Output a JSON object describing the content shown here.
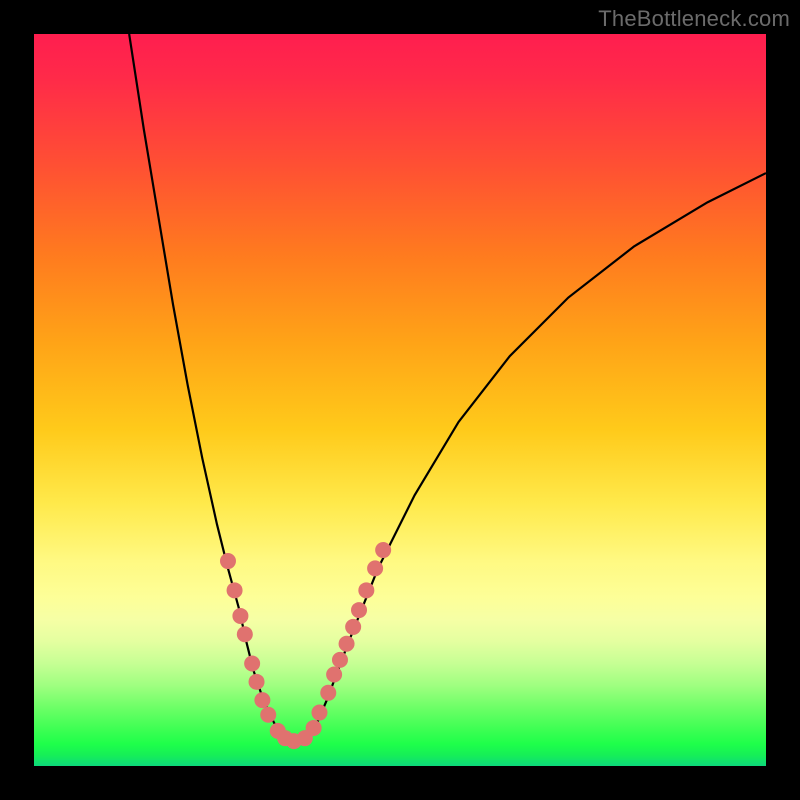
{
  "watermark": {
    "text": "TheBottleneck.com"
  },
  "colors": {
    "curve_stroke": "#000000",
    "marker_fill": "#e0726f",
    "marker_stroke": "#c85a58"
  },
  "chart_data": {
    "type": "line",
    "title": "",
    "xlabel": "",
    "ylabel": "",
    "xlim": [
      0,
      100
    ],
    "ylim": [
      0,
      100
    ],
    "grid": false,
    "legend": false,
    "series": [
      {
        "name": "bottleneck-curve",
        "x": [
          13,
          15,
          17,
          19,
          21,
          23,
          25,
          26.5,
          28,
          29,
          30,
          31,
          32,
          33,
          34,
          35,
          36,
          37,
          38.5,
          40,
          43,
          47,
          52,
          58,
          65,
          73,
          82,
          92,
          100
        ],
        "y": [
          100,
          87,
          75,
          63,
          52,
          42,
          33,
          27,
          21.5,
          17,
          13,
          10,
          7.5,
          5.5,
          4,
          3.4,
          3.3,
          3.8,
          5.5,
          9,
          17,
          27,
          37,
          47,
          56,
          64,
          71,
          77,
          81
        ]
      }
    ],
    "markers": [
      {
        "x": 26.5,
        "y": 28
      },
      {
        "x": 27.4,
        "y": 24
      },
      {
        "x": 28.2,
        "y": 20.5
      },
      {
        "x": 28.8,
        "y": 18
      },
      {
        "x": 29.8,
        "y": 14
      },
      {
        "x": 30.4,
        "y": 11.5
      },
      {
        "x": 31.2,
        "y": 9
      },
      {
        "x": 32.0,
        "y": 7
      },
      {
        "x": 33.3,
        "y": 4.8
      },
      {
        "x": 34.3,
        "y": 3.8
      },
      {
        "x": 35.5,
        "y": 3.4
      },
      {
        "x": 37.0,
        "y": 3.8
      },
      {
        "x": 38.2,
        "y": 5.2
      },
      {
        "x": 39.0,
        "y": 7.3
      },
      {
        "x": 40.2,
        "y": 10
      },
      {
        "x": 41.0,
        "y": 12.5
      },
      {
        "x": 41.8,
        "y": 14.5
      },
      {
        "x": 42.7,
        "y": 16.7
      },
      {
        "x": 43.6,
        "y": 19
      },
      {
        "x": 44.4,
        "y": 21.3
      },
      {
        "x": 45.4,
        "y": 24
      },
      {
        "x": 46.6,
        "y": 27
      },
      {
        "x": 47.7,
        "y": 29.5
      }
    ]
  }
}
